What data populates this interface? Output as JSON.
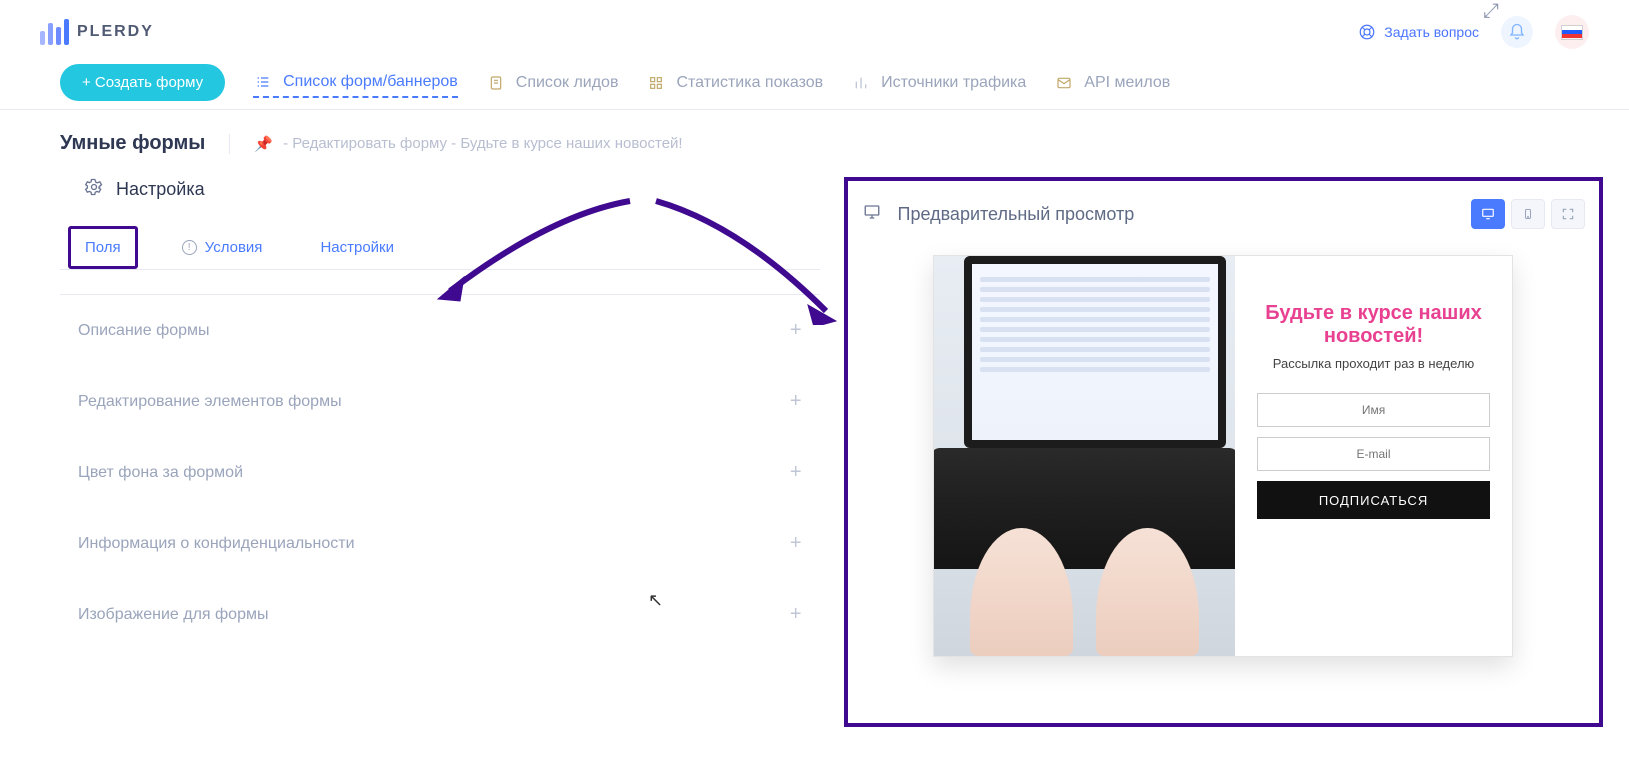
{
  "brand": "PLERDY",
  "header": {
    "ask_label": "Задать вопрос"
  },
  "nav": {
    "create_label": "+   Создать форму",
    "items": [
      {
        "label": "Список форм/баннеров"
      },
      {
        "label": "Список лидов"
      },
      {
        "label": "Статистика показов"
      },
      {
        "label": "Источники трафика"
      },
      {
        "label": "API меилов"
      }
    ]
  },
  "page": {
    "title": "Умные формы",
    "context": "- Редактировать форму - Будьте в курсе наших новостей!"
  },
  "settings_title": "Настройка",
  "tabs": {
    "fields": "Поля",
    "conditions": "Условия",
    "settings": "Настройки"
  },
  "accordions": [
    "Описание формы",
    "Редактирование элементов формы",
    "Цвет фона за формой",
    "Информация о конфиденциальности",
    "Изображение для формы"
  ],
  "preview": {
    "title": "Предварительный просмотр"
  },
  "popup": {
    "title": "Будьте в курсе наших новостей!",
    "subtitle": "Рассылка проходит раз в неделю",
    "name_placeholder": "Имя",
    "email_placeholder": "E-mail",
    "button": "ПОДПИСАТЬСЯ"
  }
}
